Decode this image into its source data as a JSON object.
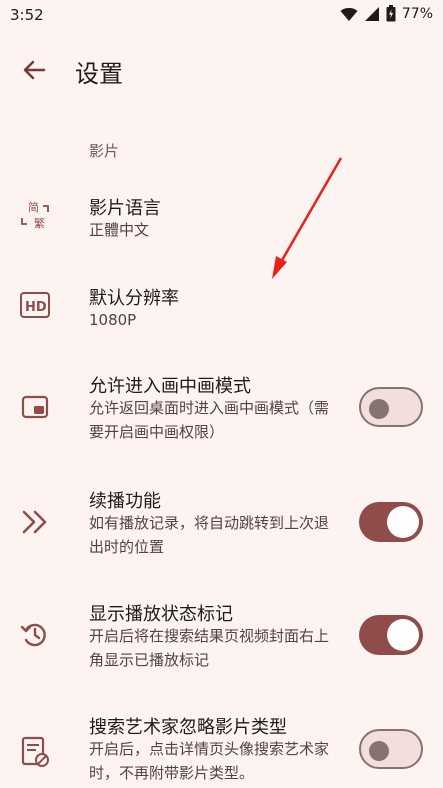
{
  "status": {
    "time": "3:52",
    "battery": "77%"
  },
  "header": {
    "title": "设置"
  },
  "section": {
    "label": "影片"
  },
  "settings": [
    {
      "title": "影片语言",
      "subtitle": "正體中文",
      "icon": "language-icon"
    },
    {
      "title": "默认分辨率",
      "subtitle": "1080P",
      "icon": "hd-icon"
    },
    {
      "title": "允许进入画中画模式",
      "subtitle": "允许返回桌面时进入画中画模式（需要开启画中画权限）",
      "icon": "picture-in-picture-icon",
      "enabled": false
    },
    {
      "title": "续播功能",
      "subtitle": "如有播放记录，将自动跳转到上次退出时的位置",
      "icon": "double-chevron-right-icon",
      "enabled": true
    },
    {
      "title": "显示播放状态标记",
      "subtitle": "开启后将在搜索结果页视频封面右上角显示已播放标记",
      "icon": "history-icon",
      "enabled": true
    },
    {
      "title": "搜索艺术家忽略影片类型",
      "subtitle": "开启后，点击详情页头像搜索艺术家时，不再附带影片类型。",
      "icon": "disabled-page-icon",
      "enabled": false
    }
  ],
  "colors": {
    "accent": "#904c4a",
    "annotation": "#e8211c",
    "background": "#fdf3f1"
  }
}
